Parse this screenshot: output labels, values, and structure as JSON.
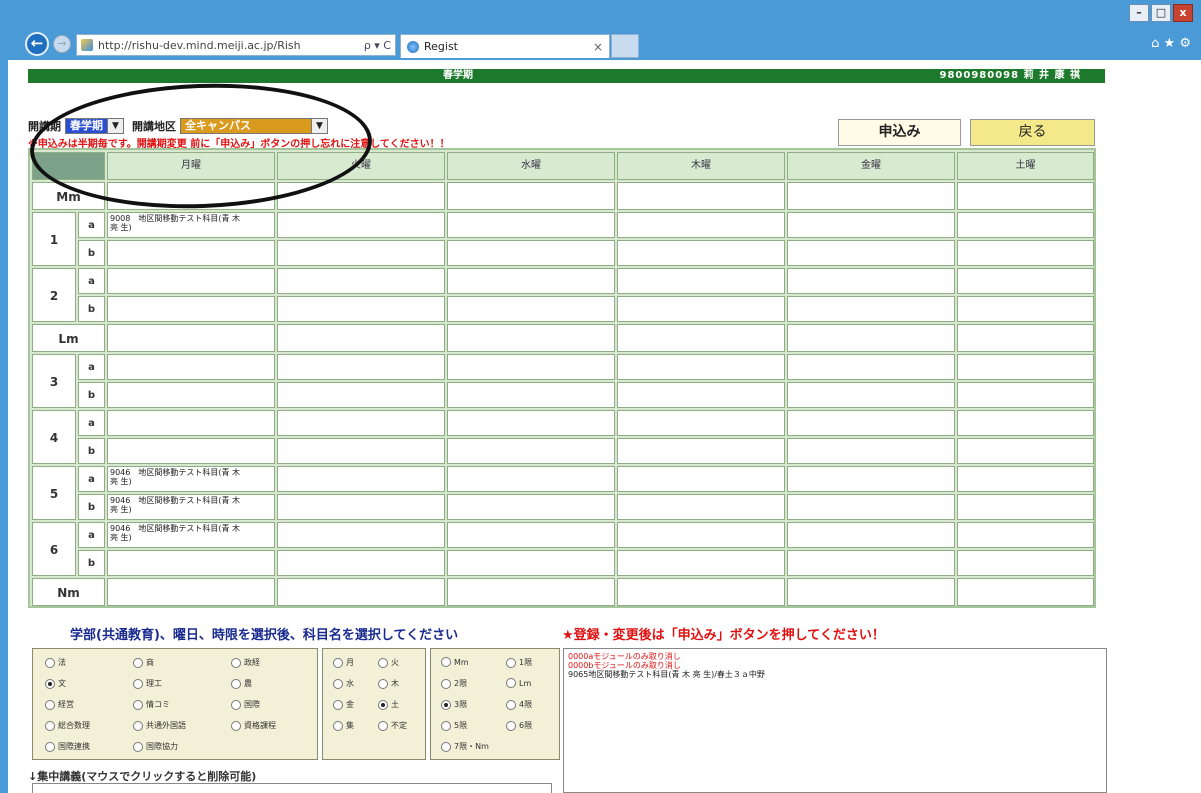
{
  "browser": {
    "url": "http://rishu-dev.mind.meiji.ac.jp/Rish",
    "tab_title": "Regist",
    "address_symbols": "ρ ▾ C",
    "tab_close": "×",
    "win_min": "–",
    "win_max": "□",
    "win_close": "x",
    "fav_icons": "⌂ ★ ⚙"
  },
  "header": {
    "term_title": "春学期",
    "user": "9800980098 莉 井 康 祺"
  },
  "controls": {
    "term_label": "開講期",
    "term_value": "春学期",
    "area_label": "開講地区",
    "area_value": "全キャンパス",
    "warning": "※申込みは半期毎です。開講期変更 前に「申込み」ボタンの押し忘れに注意してください！！",
    "apply_button": "申込み",
    "back_button": "戻る"
  },
  "grid": {
    "days": [
      "月曜",
      "火曜",
      "水曜",
      "木曜",
      "金曜",
      "土曜"
    ],
    "period_labels": {
      "mm": "Mm",
      "lm": "Lm",
      "nm": "Nm",
      "p1": "1",
      "p2": "2",
      "p3": "3",
      "p4": "4",
      "p5": "5",
      "p6": "6",
      "a": "a",
      "b": "b"
    },
    "courses": {
      "p1a_mon": "9008　地区間移動テスト科目(青 木\n亮 生)",
      "p5a_mon": "9046　地区間移動テスト科目(青 木\n亮 生)",
      "p5b_mon": "9046　地区間移動テスト科目(青 木\n亮 生)",
      "p6a_mon": "9046　地区間移動テスト科目(青 木\n亮 生)"
    }
  },
  "bottom": {
    "select_instruction": "学部(共通教育)、曜日、時限を選択後、科目名を選択してください",
    "register_notice": "★登録・変更後は「申込み」ボタンを押してください！",
    "faculties": [
      "法",
      "商",
      "政経",
      "文",
      "理工",
      "農",
      "経営",
      "情コミ",
      "国際",
      "総合数理",
      "共通外国語",
      "資格課程",
      "国際連携",
      "国際協力"
    ],
    "faculty_selected": "文",
    "days": [
      "月",
      "火",
      "水",
      "木",
      "金",
      "土",
      "集",
      "不定"
    ],
    "day_selected": "土",
    "periods": [
      "Mm",
      "1限",
      "2限",
      "Lm",
      "3限",
      "4限",
      "5限",
      "6限",
      "7限・Nm"
    ],
    "period_selected": "3限",
    "list_lines": [
      "0000aモジュールのみ取り消し",
      "0000bモジュールのみ取り消し",
      "9065地区間移動テスト科目(青 木 亮 生)/春土３ａ中野"
    ],
    "concentrated_label": "↓集中講義(マウスでクリックすると削除可能)"
  }
}
